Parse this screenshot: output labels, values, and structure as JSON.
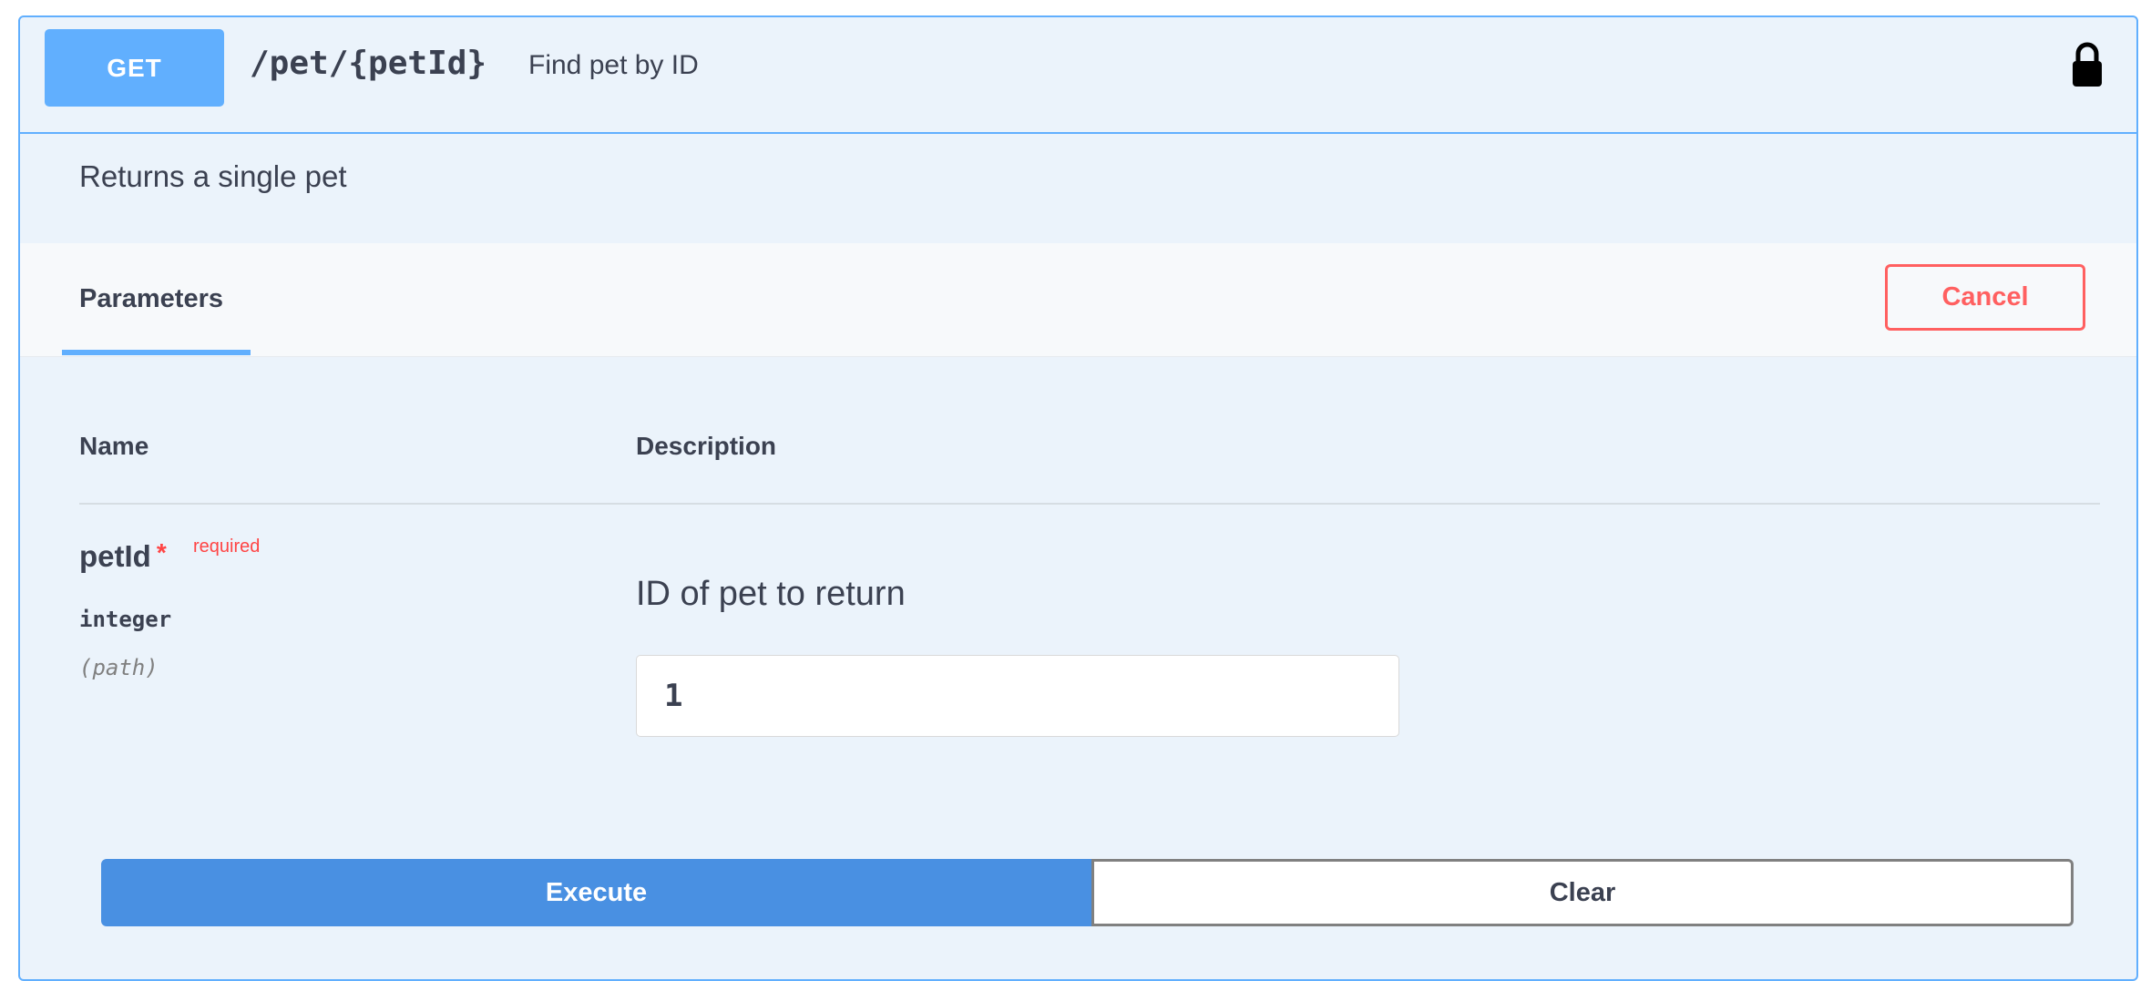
{
  "operation": {
    "method": "GET",
    "path": "/pet/{petId}",
    "summary": "Find pet by ID",
    "description": "Returns a single pet",
    "lock_icon": "lock-icon"
  },
  "parameters_section": {
    "tab_label": "Parameters",
    "cancel_label": "Cancel"
  },
  "table": {
    "headers": {
      "name": "Name",
      "description": "Description"
    },
    "rows": [
      {
        "name": "petId",
        "required_star": "*",
        "required_label": "required",
        "type": "integer",
        "in": "(path)",
        "description": "ID of pet to return",
        "value": "1"
      }
    ]
  },
  "actions": {
    "execute_label": "Execute",
    "clear_label": "Clear"
  },
  "colors": {
    "get_accent": "#61affe",
    "cancel": "#ff6060",
    "execute": "#4990e2",
    "required": "#ff4444"
  }
}
